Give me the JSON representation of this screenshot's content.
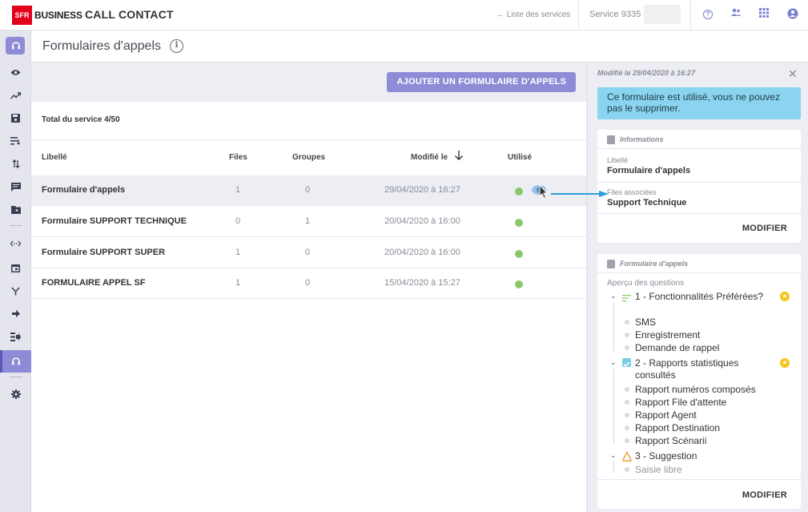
{
  "header": {
    "logo_text": "SFR",
    "logo_sub": "BUSINESS",
    "app_title": "CALL CONTACT",
    "back_link": "← Liste des services",
    "service_label": "Service 9335"
  },
  "sidebar": {
    "icons": [
      "headset-icon",
      "eye-icon",
      "trend-icon",
      "save-icon",
      "queue-icon",
      "transfer-icon",
      "message-icon",
      "folder-icon",
      "code-icon",
      "calendar-icon",
      "branch-icon",
      "arrow-right-icon",
      "routing-icon",
      "headset-icon",
      "settings-icon"
    ]
  },
  "page": {
    "title": "Formulaires d'appels"
  },
  "toolbar": {
    "add_button": "AJOUTER UN FORMULAIRE D'APPELS"
  },
  "table": {
    "total": "Total du service 4/50",
    "columns": {
      "label": "Libellé",
      "files": "Files",
      "groups": "Groupes",
      "modified": "Modifié le",
      "used": "Utilisé"
    },
    "rows": [
      {
        "label": "Formulaire d'appels",
        "files": "1",
        "groups": "0",
        "modified": "29/04/2020 à 16:27",
        "used": true
      },
      {
        "label": "Formulaire SUPPORT TECHNIQUE",
        "files": "0",
        "groups": "1",
        "modified": "20/04/2020 à 16:00",
        "used": true
      },
      {
        "label": "Formulaire SUPPORT SUPER",
        "files": "1",
        "groups": "0",
        "modified": "20/04/2020 à 16:00",
        "used": true
      },
      {
        "label": "FORMULAIRE APPEL SF",
        "files": "1",
        "groups": "0",
        "modified": "15/04/2020 à 15:27",
        "used": true
      }
    ],
    "selected_row": 0,
    "used_color": "#8bc86a"
  },
  "panel": {
    "modified": "Modifié le 29/04/2020 à 16:27",
    "banner": "Ce formulaire est utilisé, vous ne pouvez pas le supprimer.",
    "info_card": {
      "title": "Informations",
      "label_caption": "Libellé",
      "label_value": "Formulaire d'appels",
      "files_caption": "Files associées",
      "files_value": "Support Technique",
      "button": "MODIFIER"
    },
    "form_card": {
      "title": "Formulaire d'appels",
      "preview_caption": "Aperçu des questions",
      "questions": [
        {
          "text": "1 - Fonctionnalités Préférées?",
          "icon": "list-icon",
          "required": true,
          "options": [
            "SMS",
            "Enregistrement",
            "Demande de rappel"
          ]
        },
        {
          "text": "2 - Rapports statistiques consultés",
          "icon": "checkbox-icon",
          "required": true,
          "options": [
            "Rapport numéros composés",
            "Rapport File d'attente",
            "Rapport Agent",
            "Rapport Destination",
            "Rapport Scénarii"
          ]
        },
        {
          "text": "3 - Suggestion",
          "icon": "text-icon",
          "required": false,
          "options": [
            "Saisie libre"
          ]
        }
      ],
      "button": "MODIFIER"
    }
  },
  "colors": {
    "accent": "#8e8cd6",
    "banner": "#8ad4ef",
    "star": "#f5c518"
  }
}
